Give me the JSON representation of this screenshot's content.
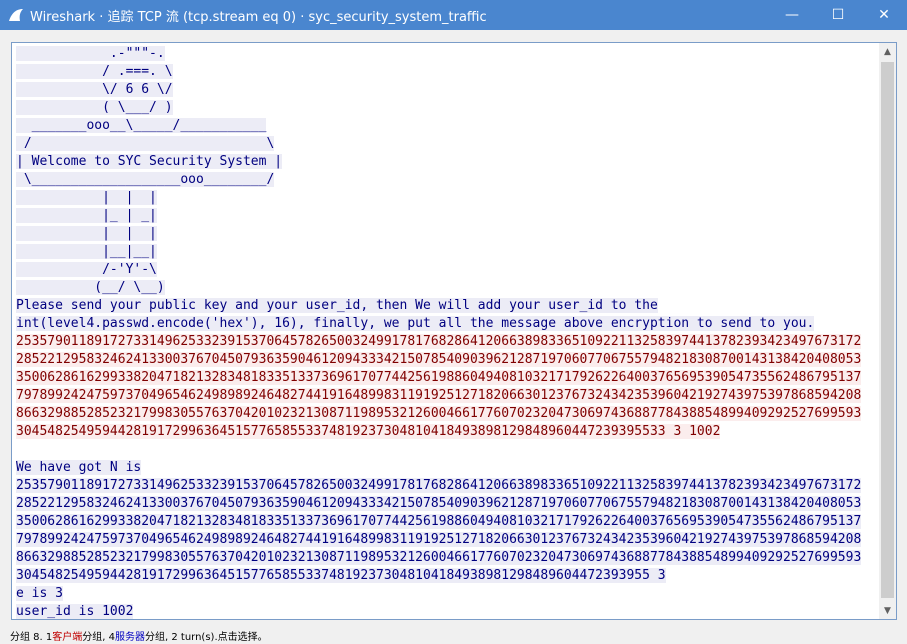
{
  "window": {
    "title": "Wireshark · 追踪 TCP 流 (tcp.stream eq 0) · syc_security_system_traffic",
    "minimize": "—",
    "maximize": "☐",
    "close": "✕"
  },
  "stream": [
    {
      "dir": "srv",
      "text": "            .-\"\"\"-."
    },
    {
      "dir": "srv",
      "text": "           / .===. \\"
    },
    {
      "dir": "srv",
      "text": "           \\/ 6 6 \\/"
    },
    {
      "dir": "srv",
      "text": "           ( \\___/ )"
    },
    {
      "dir": "srv",
      "text": "  _______ooo__\\_____/___________"
    },
    {
      "dir": "srv",
      "text": " /                              \\"
    },
    {
      "dir": "srv",
      "text": "| Welcome to SYC Security System |"
    },
    {
      "dir": "srv",
      "text": " \\___________________ooo________/"
    },
    {
      "dir": "srv",
      "text": "           |  |  |"
    },
    {
      "dir": "srv",
      "text": "           |_ | _|"
    },
    {
      "dir": "srv",
      "text": "           |  |  |"
    },
    {
      "dir": "srv",
      "text": "           |__|__|"
    },
    {
      "dir": "srv",
      "text": "           /-'Y'-\\"
    },
    {
      "dir": "srv",
      "text": "          (__/ \\__)"
    },
    {
      "dir": "srv",
      "text": "Please send your public key and your user_id, then We will add your user_id to the"
    },
    {
      "dir": "srv",
      "text": "int(level4.passwd.encode('hex'), 16), finally, we put all the message above encryption to send to you."
    },
    {
      "dir": "cli",
      "text": "253579011891727331496253323915370645782650032499178176828641206638983365109221132583974413782393423497673172"
    },
    {
      "dir": "cli",
      "text": "285221295832462413300376704507936359046120943334215078540903962128719706077067557948218308700143138420408053"
    },
    {
      "dir": "cli",
      "text": "350062861629933820471821328348183351337369617077442561988604940810321717926226400376569539054735562486795137"
    },
    {
      "dir": "cli",
      "text": "797899242475973704965462498989246482744191648998311919251271820663012376732434235396042192743975397868594208"
    },
    {
      "dir": "cli",
      "text": "866329885285232179983055763704201023213087119895321260046617760702320473069743688778438854899409292527699593"
    },
    {
      "dir": "cli",
      "text": "30454825495944281917299636451577658553374819237304810418493898129848960447239395533 3 1002"
    },
    {
      "dir": "srv",
      "text": ""
    },
    {
      "dir": "srv",
      "text": "We have got N is"
    },
    {
      "dir": "srv",
      "text": "253579011891727331496253323915370645782650032499178176828641206638983365109221132583974413782393423497673172"
    },
    {
      "dir": "srv",
      "text": "285221295832462413300376704507936359046120943334215078540903962128719706077067557948218308700143138420408053"
    },
    {
      "dir": "srv",
      "text": "350062861629933820471821328348183351337369617077442561988604940810321717926226400376569539054735562486795137"
    },
    {
      "dir": "srv",
      "text": "797899242475973704965462498989246482744191648998311919251271820663012376732434235396042192743975397868594208"
    },
    {
      "dir": "srv",
      "text": "866329885285232179983055763704201023213087119895321260046617760702320473069743688778438854899409292527699593"
    },
    {
      "dir": "srv",
      "text": "304548254959442819172996364515776585533748192373048104184938981298489604472393955 3"
    },
    {
      "dir": "srv",
      "text": "e is 3"
    },
    {
      "dir": "srv",
      "text": "user_id is 1002"
    }
  ],
  "status": {
    "part1": "分组 8. 1 ",
    "client": "客户端",
    "part2": " 分组, 4 ",
    "server": "服务器",
    "part3": " 分组, 2 turn(s).点击选择。"
  },
  "colors": {
    "titlebar": "#4a86cf",
    "server_bg": "#ececf6",
    "server_fg": "#000080",
    "client_bg": "#fbeded",
    "client_fg": "#800000"
  },
  "icons": {
    "app": "wireshark-fin-icon",
    "scroll_up": "scroll-up-arrow-icon",
    "scroll_down": "scroll-down-arrow-icon"
  }
}
